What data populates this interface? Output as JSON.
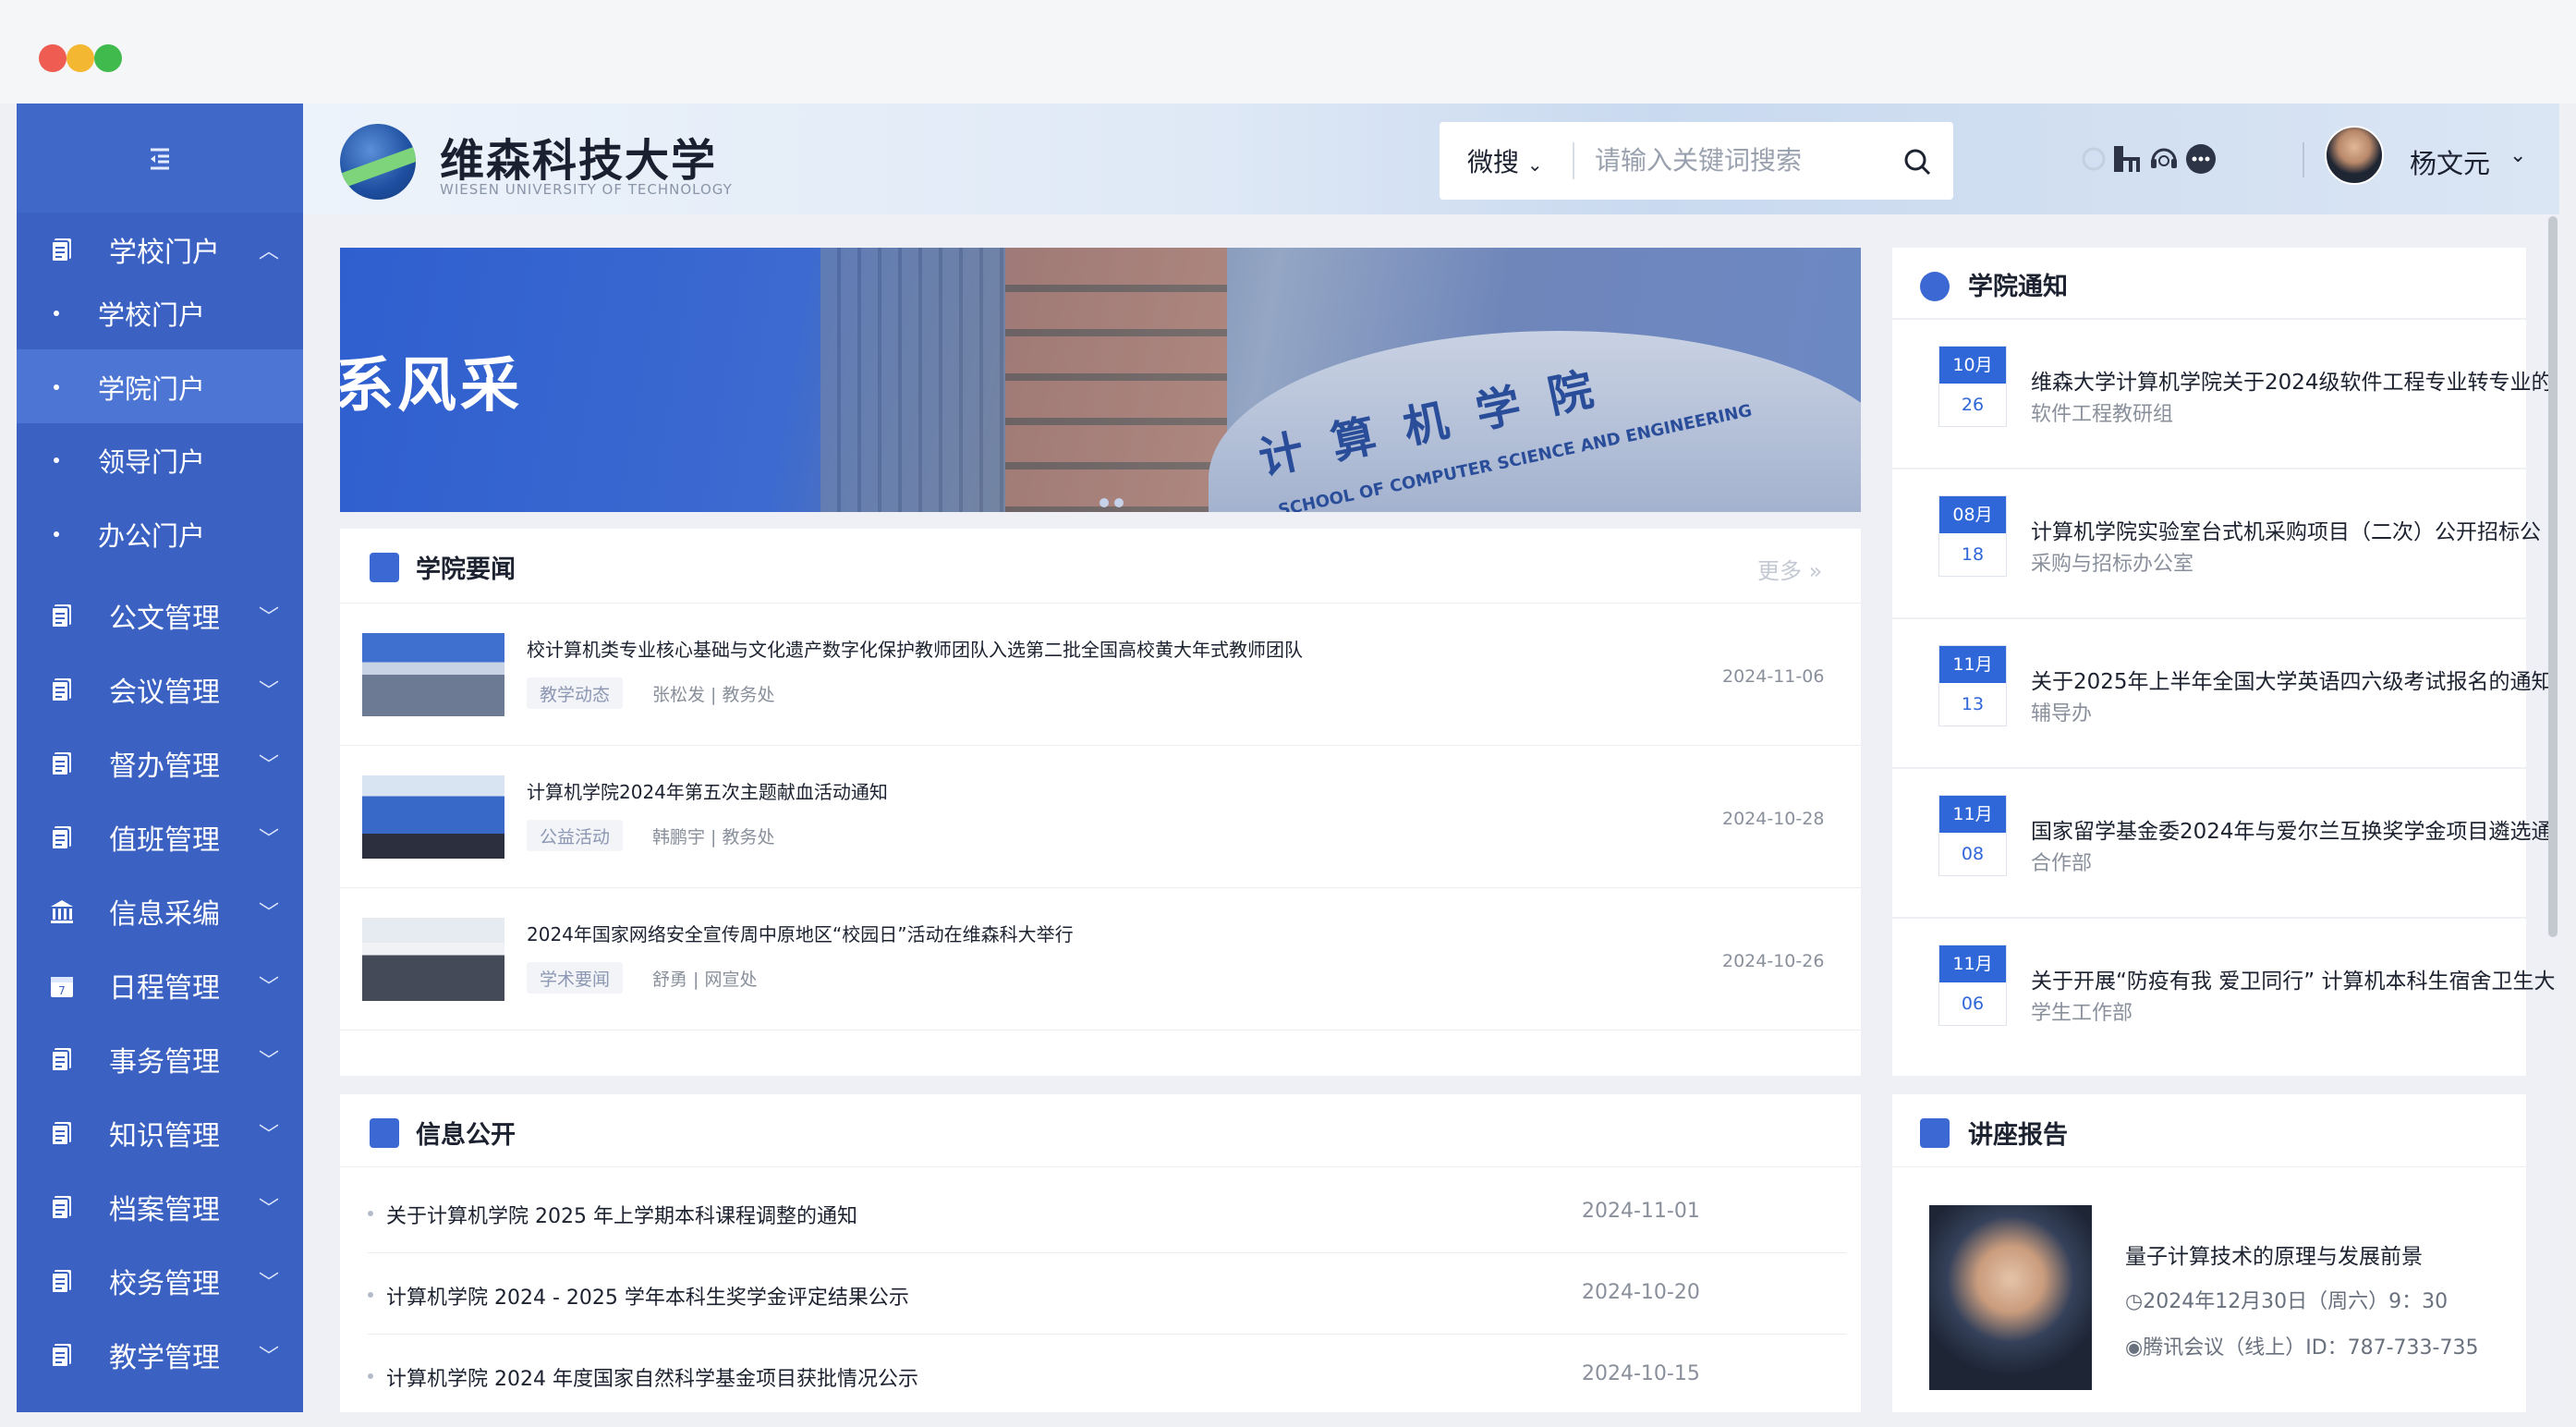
{
  "window": {
    "controls": [
      "close",
      "minimize",
      "maximize"
    ],
    "colors": {
      "close": "#ee5c52",
      "minimize": "#f3b731",
      "maximize": "#40b94d"
    }
  },
  "brand": {
    "name_cn": "维森科技大学",
    "name_en": "WIESEN UNIVERSITY OF TECHNOLOGY",
    "accent": "#3b62c3"
  },
  "sidebar": {
    "toggle_icon": "menu-collapse-icon",
    "groups": [
      {
        "label": "学校门户",
        "expanded": true,
        "icon": "document-icon"
      },
      {
        "label": "公文管理",
        "icon": "document-icon"
      },
      {
        "label": "会议管理",
        "icon": "document-icon"
      },
      {
        "label": "督办管理",
        "icon": "document-icon"
      },
      {
        "label": "值班管理",
        "icon": "document-icon"
      },
      {
        "label": "信息采编",
        "icon": "bank-icon"
      },
      {
        "label": "日程管理",
        "icon": "calendar-icon"
      },
      {
        "label": "事务管理",
        "icon": "document-icon"
      },
      {
        "label": "知识管理",
        "icon": "document-icon"
      },
      {
        "label": "档案管理",
        "icon": "document-icon"
      },
      {
        "label": "校务管理",
        "icon": "document-icon"
      },
      {
        "label": "教学管理",
        "icon": "document-icon"
      }
    ],
    "sub_items": [
      {
        "label": "学校门户",
        "active": false
      },
      {
        "label": "学院门户",
        "active": true
      },
      {
        "label": "领导门户",
        "active": false
      },
      {
        "label": "办公门户",
        "active": false
      }
    ]
  },
  "header": {
    "search": {
      "scope": "微搜",
      "placeholder": "请输入关键词搜索"
    },
    "icons": [
      "refresh-icon",
      "org-chart-icon",
      "headset-icon",
      "more-icon"
    ],
    "user": {
      "name": "杨文元"
    }
  },
  "banner": {
    "title": "系风采",
    "building_name": "计算机学院",
    "building_sub": "SCHOOL OF COMPUTER SCIENCE AND ENGINEERING"
  },
  "news": {
    "title": "学院要闻",
    "more": "更多 »",
    "items": [
      {
        "title": "校计算机类专业核心基础与文化遗产数字化保护教师团队入选第二批全国高校黄大年式教师团队",
        "tag": "教学动态",
        "meta": "张松发 | 教务处",
        "date": "2024-11-06"
      },
      {
        "title": "计算机学院2024年第五次主题献血活动通知",
        "tag": "公益活动",
        "meta": "韩鹏宇 | 教务处",
        "date": "2024-10-28"
      },
      {
        "title": "2024年国家网络安全宣传周中原地区“校园日”活动在维森科大举行",
        "tag": "学术要闻",
        "meta": "舒勇 | 网宣处",
        "date": "2024-10-26"
      }
    ]
  },
  "notices": {
    "title": "学院通知",
    "items": [
      {
        "month": "10月",
        "day": "26",
        "title": "维森大学计算机学院关于2024级软件工程专业转专业的",
        "dept": "软件工程教研组"
      },
      {
        "month": "08月",
        "day": "18",
        "title": "计算机学院实验室台式机采购项目（二次）公开招标公",
        "dept": "采购与招标办公室"
      },
      {
        "month": "11月",
        "day": "13",
        "title": "关于2025年上半年全国大学英语四六级考试报名的通知",
        "dept": "辅导办"
      },
      {
        "month": "11月",
        "day": "08",
        "title": "国家留学基金委2024年与爱尔兰互换奖学金项目遴选通",
        "dept": "合作部"
      },
      {
        "month": "11月",
        "day": "06",
        "title": "关于开展“防疫有我 爱卫同行” 计算机本科生宿舍卫生大",
        "dept": "学生工作部"
      }
    ]
  },
  "info": {
    "title": "信息公开",
    "items": [
      {
        "title": "关于计算机学院 2025 年上学期本科课程调整的通知",
        "date": "2024-11-01"
      },
      {
        "title": "计算机学院 2024 - 2025 学年本科生奖学金评定结果公示",
        "date": "2024-10-20"
      },
      {
        "title": "计算机学院 2024 年度国家自然科学基金项目获批情况公示",
        "date": "2024-10-15"
      }
    ]
  },
  "lecture": {
    "title": "讲座报告",
    "item": {
      "title": "量子计算技术的原理与发展前景",
      "time": "2024年12月30日（周六）9：30",
      "place": "腾讯会议（线上）ID：787-733-735"
    }
  }
}
